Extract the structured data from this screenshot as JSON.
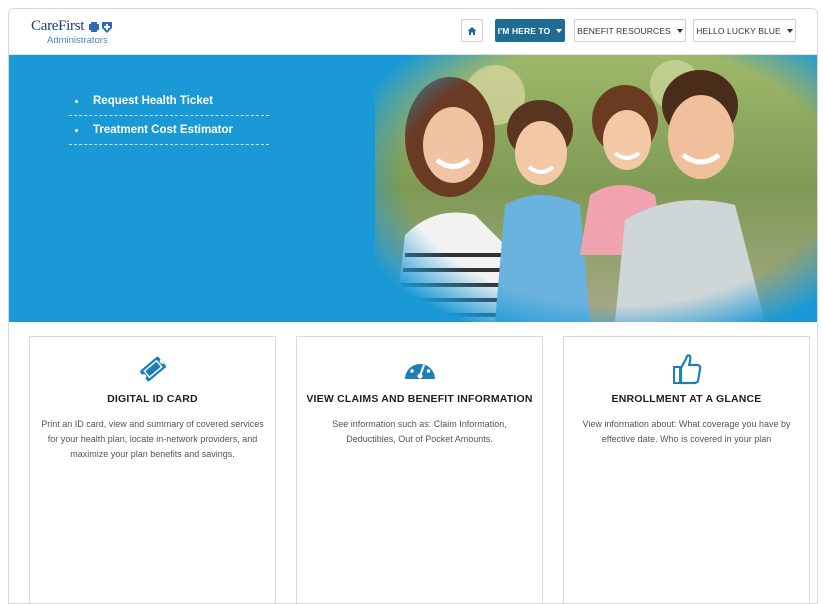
{
  "header": {
    "logo": {
      "name": "CareFirst",
      "sub": "Administrators"
    },
    "nav": {
      "home_icon": "home-icon",
      "here_to": "I'M HERE TO",
      "benefit_resources": "BENEFIT RESOURCES",
      "hello": "HELLO LUCKY BLUE"
    }
  },
  "hero": {
    "links": [
      "Request Health Ticket",
      "Treatment Cost Estimator"
    ],
    "image": "family-photo"
  },
  "cards": [
    {
      "icon": "ticket-icon",
      "title": "DIGITAL ID CARD",
      "description": "Print an ID card, view and summary of covered services for your health plan, locate in-network providers, and maximize your plan benefits and savings."
    },
    {
      "icon": "dashboard-gauge-icon",
      "title": "VIEW CLAIMS AND BENEFIT INFORMATION",
      "description": "See information such as: Claim Information, Deductibles, Out of Pocket Amounts."
    },
    {
      "icon": "thumbs-up-icon",
      "title": "ENROLLMENT AT A GLANCE",
      "description": "View information about: What coverage you have by effective date. Who is covered in your plan"
    }
  ],
  "colors": {
    "accent": "#1a99d6",
    "nav_active": "#1f6c93",
    "brand": "#1b3d7a"
  }
}
